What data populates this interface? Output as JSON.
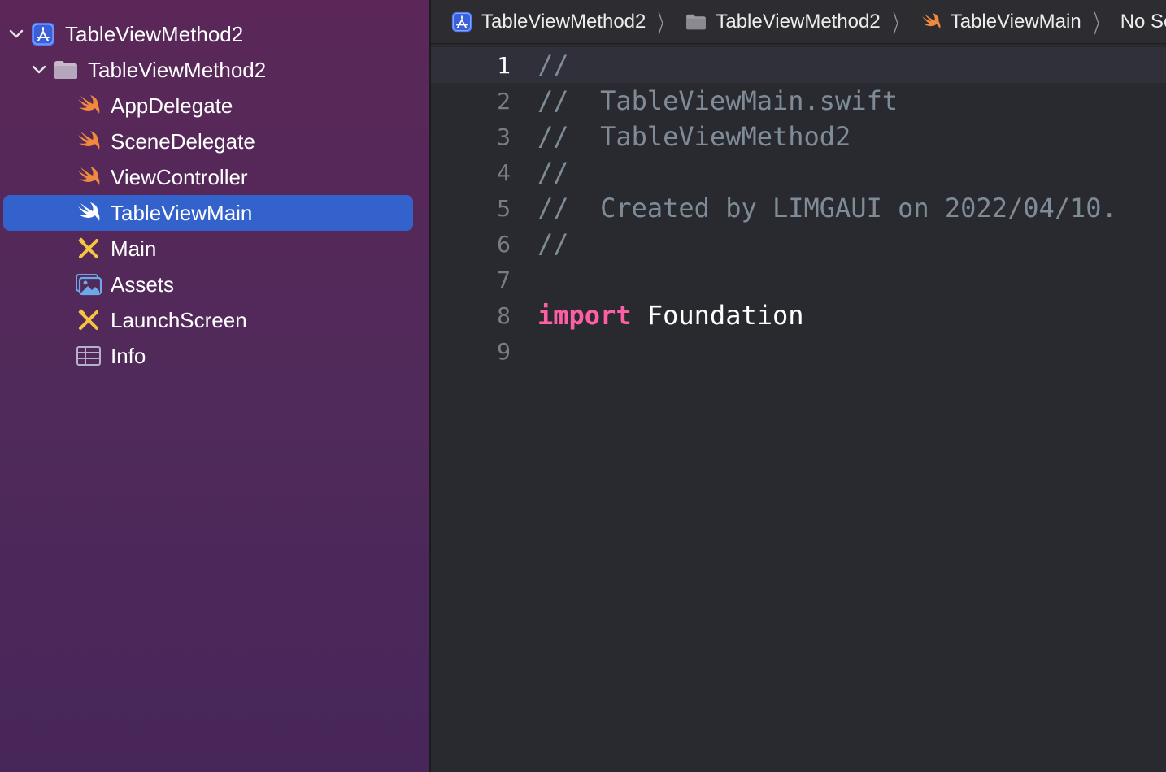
{
  "navigator": {
    "items": [
      {
        "label": "TableViewMethod2",
        "icon": "xcode-project-icon",
        "level": 0,
        "expanded": true
      },
      {
        "label": "TableViewMethod2",
        "icon": "folder-icon",
        "level": 1,
        "expanded": true
      },
      {
        "label": "AppDelegate",
        "icon": "swift-file-icon",
        "level": 2
      },
      {
        "label": "SceneDelegate",
        "icon": "swift-file-icon",
        "level": 2
      },
      {
        "label": "ViewController",
        "icon": "swift-file-icon",
        "level": 2
      },
      {
        "label": "TableViewMain",
        "icon": "swift-file-icon",
        "level": 2,
        "selected": true
      },
      {
        "label": "Main",
        "icon": "storyboard-icon",
        "level": 2
      },
      {
        "label": "Assets",
        "icon": "asset-catalog-icon",
        "level": 2
      },
      {
        "label": "LaunchScreen",
        "icon": "storyboard-icon",
        "level": 2
      },
      {
        "label": "Info",
        "icon": "plist-icon",
        "level": 2
      }
    ]
  },
  "jumpbar": {
    "project": "TableViewMethod2",
    "group": "TableViewMethod2",
    "file": "TableViewMain",
    "symbol": "No Selection"
  },
  "editor": {
    "current_line": 1,
    "lines": [
      {
        "num": "1",
        "comment": "//"
      },
      {
        "num": "2",
        "comment": "//  TableViewMain.swift"
      },
      {
        "num": "3",
        "comment": "//  TableViewMethod2"
      },
      {
        "num": "4",
        "comment": "//"
      },
      {
        "num": "5",
        "comment": "//  Created by LIMGAUI on 2022/04/10."
      },
      {
        "num": "6",
        "comment": "//"
      },
      {
        "num": "7"
      },
      {
        "num": "8",
        "keyword": "import",
        "text": " Foundation"
      },
      {
        "num": "9"
      }
    ]
  },
  "colors": {
    "sidebar_bg": "#5a2758",
    "selection": "#3462cc",
    "editor_bg": "#292a30",
    "keyword": "#fc5fa3",
    "comment": "#7f8c98",
    "swift_orange": "#f0883e",
    "xcode_blue": "#4f7bff"
  }
}
